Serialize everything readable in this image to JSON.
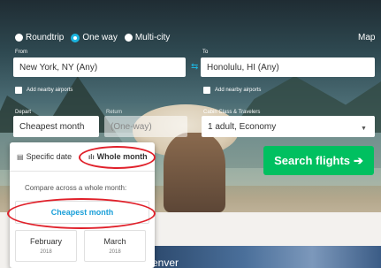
{
  "trip_type": {
    "options": [
      {
        "label": "Roundtrip",
        "selected": false
      },
      {
        "label": "One way",
        "selected": true
      },
      {
        "label": "Multi-city",
        "selected": false
      }
    ]
  },
  "map_label": "Map",
  "from": {
    "label": "From",
    "value": "New York, NY (Any)",
    "nearby": "Add nearby airports"
  },
  "to": {
    "label": "To",
    "value": "Honolulu, HI (Any)",
    "nearby": "Add nearby airports"
  },
  "depart": {
    "label": "Depart",
    "value": "Cheapest month"
  },
  "return": {
    "label": "Return",
    "placeholder": "(One-way)"
  },
  "cabin": {
    "label": "Cabin Class & Travelers",
    "value": "1 adult, Economy"
  },
  "search_button": {
    "label": "Search flights",
    "icon": "arrow-right-icon"
  },
  "date_panel": {
    "tabs": [
      {
        "label": "Specific date",
        "icon": "calendar-icon",
        "active": false
      },
      {
        "label": "Whole month",
        "icon": "bar-chart-icon",
        "active": true
      }
    ],
    "compare_text": "Compare across a whole month:",
    "cheapest_label": "Cheapest month",
    "months": [
      {
        "name": "February",
        "year": "2018"
      },
      {
        "name": "March",
        "year": "2018"
      }
    ]
  },
  "background_text": "enver",
  "colors": {
    "accent": "#1cb5e0",
    "search_green": "#00c060",
    "annotation_red": "#e0202a"
  }
}
